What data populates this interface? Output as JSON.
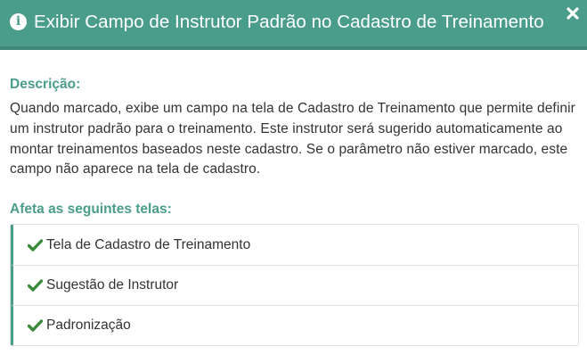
{
  "header": {
    "title": "Exibir Campo de Instrutor Padrão no Cadastro de Treinamento",
    "info_icon": "info-circle-icon",
    "close_icon": "close-icon",
    "background_color": "#4a9d8b"
  },
  "description": {
    "label": "Descrição:",
    "text": "Quando marcado, exibe um campo na tela de Cadastro de Treinamento que permite definir um instrutor padrão para o treinamento. Este instrutor será sugerido automaticamente ao montar treinamentos baseados neste cadastro. Se o parâmetro não estiver marcado, este campo não aparece na tela de cadastro."
  },
  "affected_screens": {
    "label": "Afeta as seguintes telas:",
    "check_icon": "check-icon",
    "check_color": "#3a8a3a",
    "items": [
      {
        "label": "Tela de Cadastro de Treinamento"
      },
      {
        "label": "Sugestão de Instrutor"
      },
      {
        "label": "Padronização"
      }
    ]
  }
}
